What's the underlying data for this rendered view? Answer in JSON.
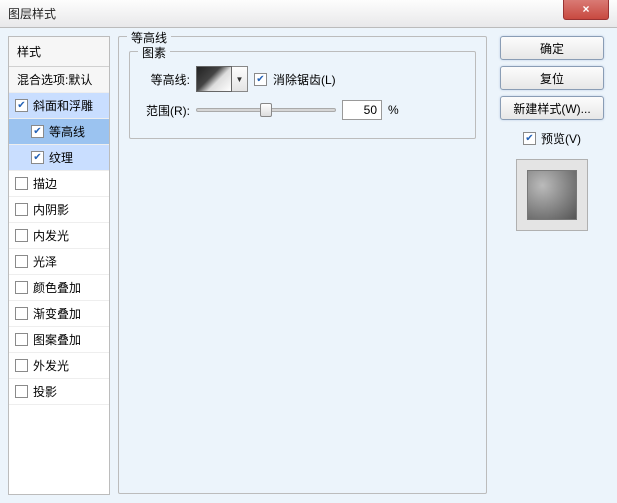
{
  "window_title": "图层样式",
  "close_icon": "×",
  "styles_header": "样式",
  "blending_label": "混合选项:默认",
  "styles": [
    {
      "label": "斜面和浮雕",
      "checked": true,
      "selected": "light"
    },
    {
      "label": "等高线",
      "checked": true,
      "sub": true,
      "selected": "sel"
    },
    {
      "label": "纹理",
      "checked": true,
      "sub": true,
      "selected": "light"
    },
    {
      "label": "描边",
      "checked": false
    },
    {
      "label": "内阴影",
      "checked": false
    },
    {
      "label": "内发光",
      "checked": false
    },
    {
      "label": "光泽",
      "checked": false
    },
    {
      "label": "颜色叠加",
      "checked": false
    },
    {
      "label": "渐变叠加",
      "checked": false
    },
    {
      "label": "图案叠加",
      "checked": false
    },
    {
      "label": "外发光",
      "checked": false
    },
    {
      "label": "投影",
      "checked": false
    }
  ],
  "main": {
    "group_label": "等高线",
    "subgroup_label": "图素",
    "contour_label": "等高线:",
    "antialias_label": "消除锯齿(L)",
    "antialias_checked": true,
    "range_label": "范围(R):",
    "range_value": "50",
    "range_unit": "%"
  },
  "buttons": {
    "ok": "确定",
    "cancel": "复位",
    "new_style": "新建样式(W)..."
  },
  "preview": {
    "label": "预览(V)",
    "checked": true
  }
}
